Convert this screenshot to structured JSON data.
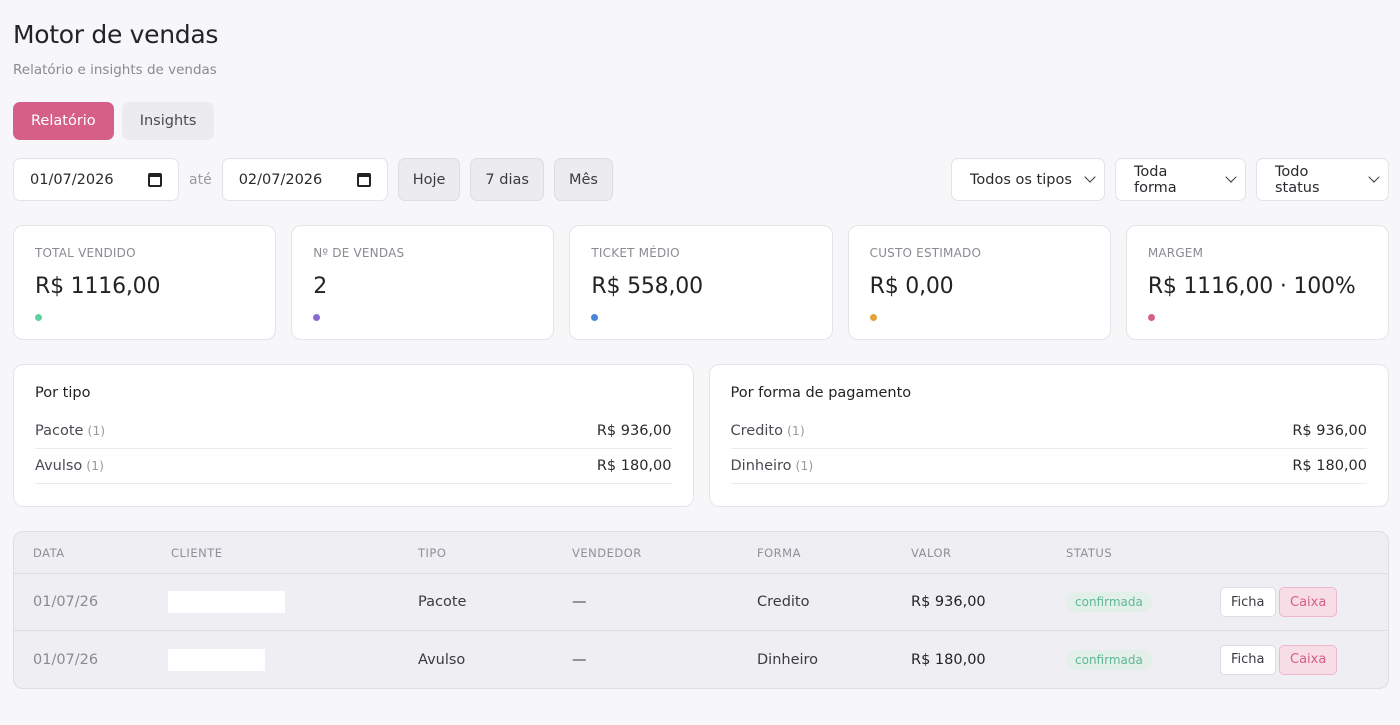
{
  "header": {
    "title": "Motor de vendas",
    "subtitle": "Relatório e insights de vendas"
  },
  "tabs": [
    {
      "label": "Relatório",
      "active": true
    },
    {
      "label": "Insights",
      "active": false
    }
  ],
  "filters": {
    "date_from": "01/07/2026",
    "separator": "até",
    "date_to": "02/07/2026",
    "quick_ranges": [
      "Hoje",
      "7 dias",
      "Mês"
    ],
    "selects": [
      "Todos os tipos",
      "Toda forma",
      "Todo status"
    ]
  },
  "stats": [
    {
      "label": "Total vendido",
      "value": "R$ 1116,00",
      "color": "#5fcfa0"
    },
    {
      "label": "Nº de vendas",
      "value": "2",
      "color": "#8a6bd1"
    },
    {
      "label": "Ticket médio",
      "value": "R$ 558,00",
      "color": "#4a86d8"
    },
    {
      "label": "Custo estimado",
      "value": "R$ 0,00",
      "color": "#e0a33c"
    },
    {
      "label": "Margem",
      "value": "R$ 1116,00 · 100%",
      "color": "#d55f86"
    }
  ],
  "breakdowns": [
    {
      "title": "Por tipo",
      "rows": [
        {
          "name": "Pacote",
          "count": "(1)",
          "value": "R$ 936,00"
        },
        {
          "name": "Avulso",
          "count": "(1)",
          "value": "R$ 180,00"
        }
      ]
    },
    {
      "title": "Por forma de pagamento",
      "rows": [
        {
          "name": "Credito",
          "count": "(1)",
          "value": "R$ 936,00"
        },
        {
          "name": "Dinheiro",
          "count": "(1)",
          "value": "R$ 180,00"
        }
      ]
    }
  ],
  "table": {
    "columns": [
      "Data",
      "Cliente",
      "Tipo",
      "Vendedor",
      "Forma",
      "Valor",
      "Status"
    ],
    "rows": [
      {
        "data": "01/07/26",
        "tipo": "Pacote",
        "vendedor": "—",
        "forma": "Credito",
        "valor": "R$ 936,00",
        "status": "confirmada",
        "ficha": "Ficha",
        "caixa": "Caixa"
      },
      {
        "data": "01/07/26",
        "tipo": "Avulso",
        "vendedor": "—",
        "forma": "Dinheiro",
        "valor": "R$ 180,00",
        "status": "confirmada",
        "ficha": "Ficha",
        "caixa": "Caixa"
      }
    ]
  }
}
